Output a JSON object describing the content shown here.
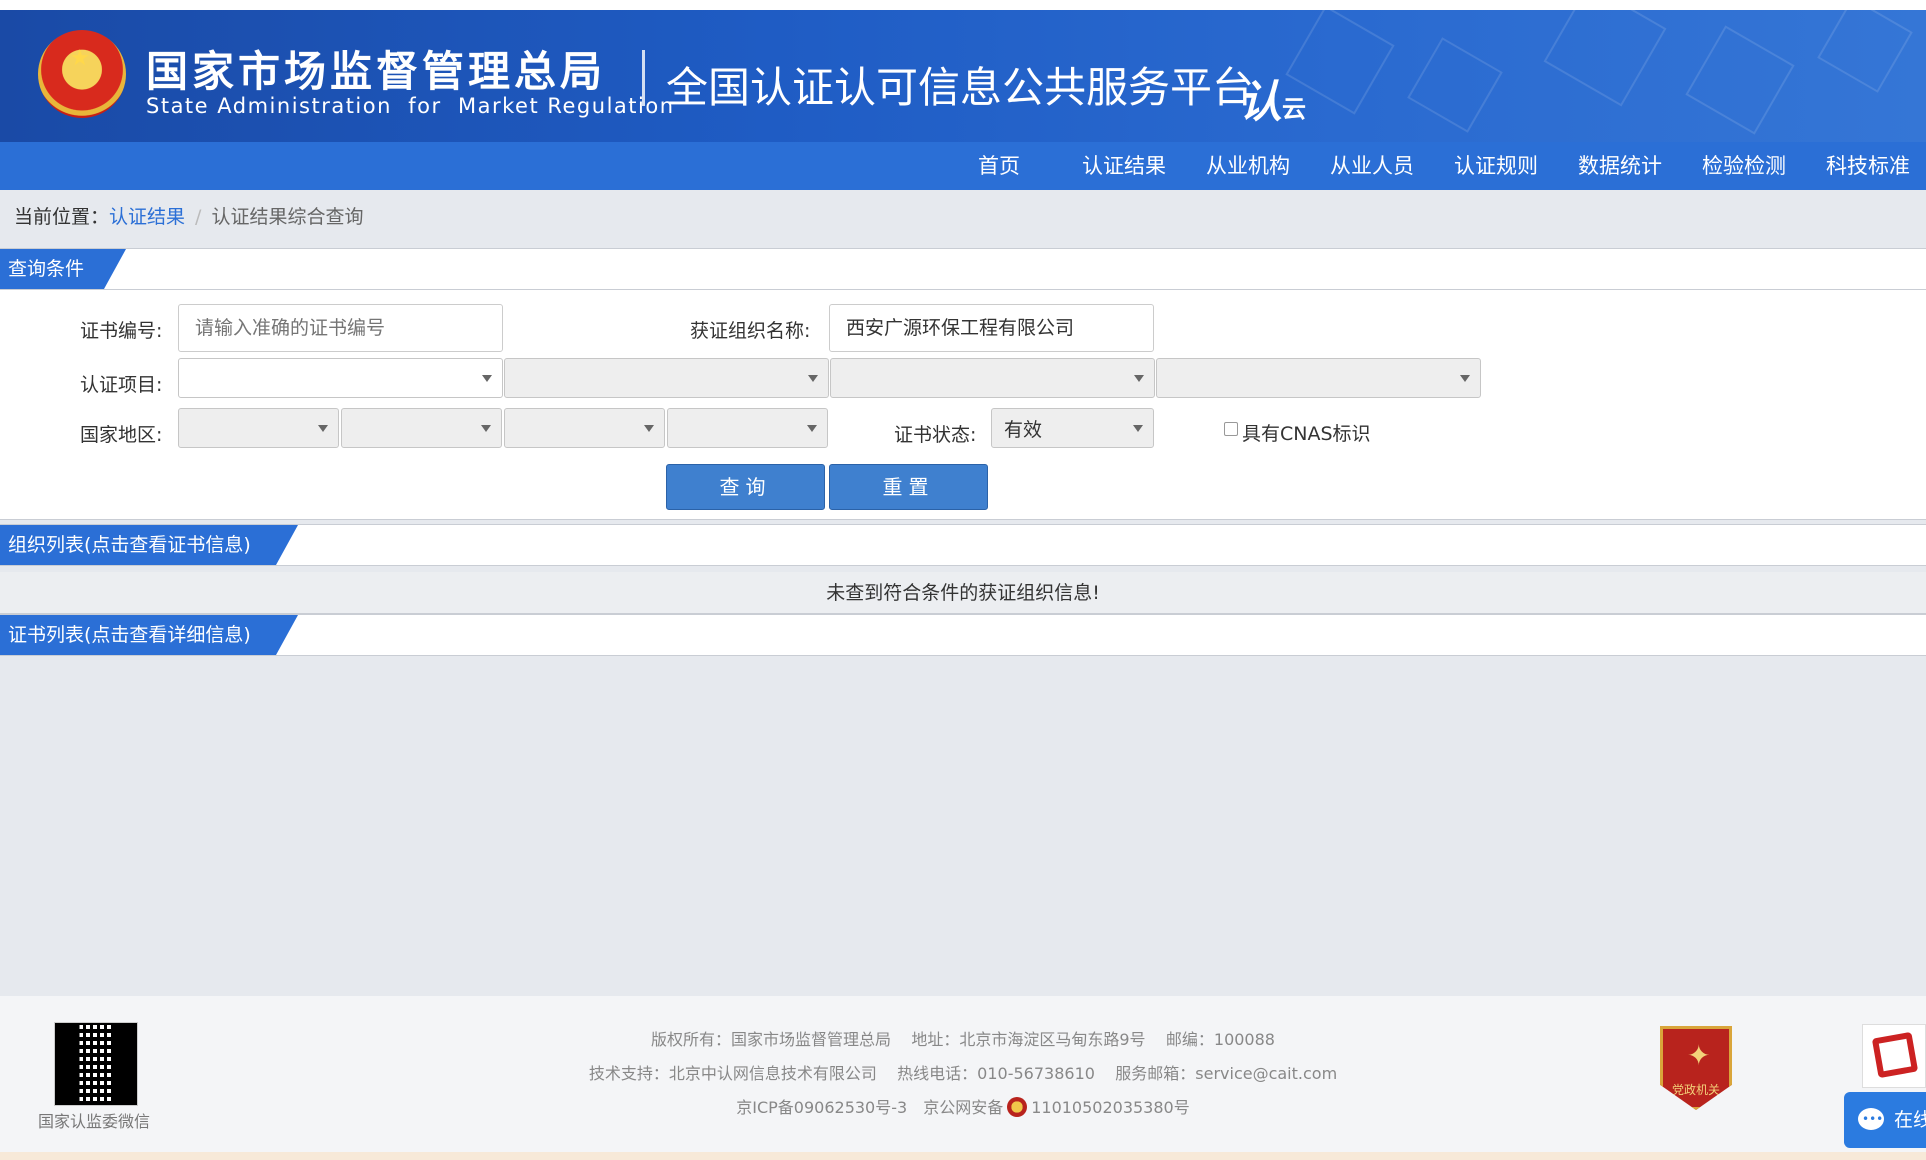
{
  "header": {
    "org_cn": "国家市场监督管理总局",
    "org_en": "State Administration  for  Market Regulation",
    "platform_title": "全国认证认可信息公共服务平台",
    "logo_text": "认",
    "logo_sub": "云"
  },
  "nav": {
    "items": [
      "首页",
      "认证结果",
      "从业机构",
      "从业人员",
      "认证规则",
      "数据统计",
      "检验检测",
      "科技标准"
    ]
  },
  "breadcrumb": {
    "prefix": "当前位置：",
    "link": "认证结果",
    "separator": "/",
    "current": "认证结果综合查询"
  },
  "query": {
    "section_title": "查询条件",
    "cert_no_label": "证书编号:",
    "cert_no_placeholder": "请输入准确的证书编号",
    "org_name_label": "获证组织名称:",
    "org_name_value": "西安广源环保工程有限公司",
    "project_label": "认证项目:",
    "region_label": "国家地区:",
    "status_label": "证书状态:",
    "status_value": "有效",
    "cnas_label": "具有CNAS标识",
    "search_button": "查询",
    "reset_button": "重置"
  },
  "org_list": {
    "section_title": "组织列表(点击查看证书信息)",
    "empty_message": "未查到符合条件的获证组织信息!"
  },
  "cert_list": {
    "section_title": "证书列表(点击查看详细信息)"
  },
  "footer": {
    "qr_caption": "国家认监委微信",
    "line1": "版权所有：国家市场监督管理总局    地址：北京市海淀区马甸东路9号    邮编：100088",
    "line2": "技术支持：北京中认网信息技术有限公司    热线电话：010-56738610    服务邮箱：service@cait.com",
    "icp": "京ICP备09062530号-3",
    "police_label": "京公网安备",
    "police_no": "11010502035380号",
    "badge_text": "党政机关",
    "online_label": "在线"
  },
  "colors": {
    "brand_blue": "#2b6fd6",
    "banner_blue": "#1a4aa6",
    "button_blue": "#3f80cf"
  }
}
